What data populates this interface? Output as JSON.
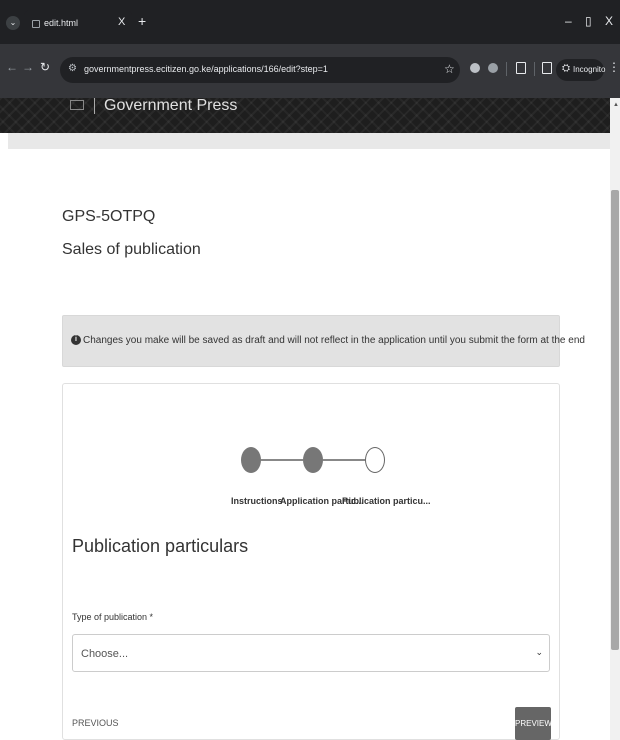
{
  "browser": {
    "tab_title": "edit.html",
    "tab_close": "X",
    "new_tab": "+",
    "url": "governmentpress.ecitizen.go.ke/applications/166/edit?step=1",
    "incognito_label": "Incognito",
    "window_minimize": "–",
    "window_restore": "▯",
    "window_close": "X"
  },
  "site": {
    "title": "Government Press"
  },
  "application": {
    "id": "GPS-5OTPQ",
    "type": "Sales of publication"
  },
  "alert": {
    "icon": "info-icon",
    "text": "Changes you make will be saved as draft and will not reflect in the application until you submit the form at the end"
  },
  "wizard": {
    "steps": [
      {
        "label": "Instructions",
        "state": "done"
      },
      {
        "label": "Application partic...",
        "state": "done"
      },
      {
        "label": "Publication particu...",
        "state": "current"
      }
    ]
  },
  "form": {
    "section_title": "Publication particulars",
    "type_label": "Type of publication *",
    "type_value": "Choose..."
  },
  "actions": {
    "previous": "PREVIOUS",
    "preview": "PREVIEW"
  }
}
